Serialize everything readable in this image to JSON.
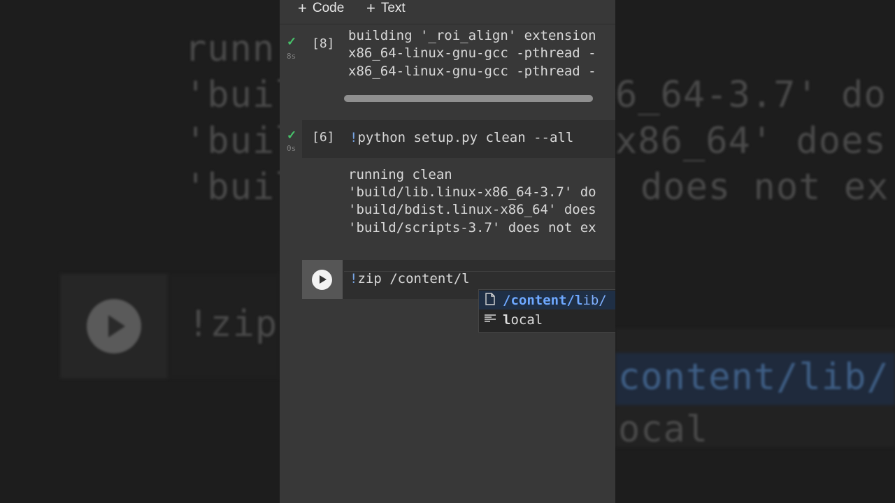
{
  "toolbar": {
    "add_code_label": "Code",
    "add_text_label": "Text"
  },
  "cells": {
    "c8": {
      "exec_count": "[8]",
      "exec_time": "8s",
      "output_lines": [
        "building '_roi_align' extension",
        "x86_64-linux-gnu-gcc -pthread -",
        "x86_64-linux-gnu-gcc -pthread -"
      ]
    },
    "c6": {
      "exec_count": "[6]",
      "exec_time": "0s",
      "bang": "!",
      "code": "python setup.py clean --all",
      "output_lines": [
        "running clean",
        "'build/lib.linux-x86_64-3.7' do",
        "'build/bdist.linux-x86_64' does",
        "'build/scripts-3.7' does not ex"
      ]
    },
    "active": {
      "bang": "!",
      "code": "zip /content/l"
    }
  },
  "autocomplete": {
    "items": [
      {
        "match": "/content/l",
        "rest": "ib/",
        "icon": "file-icon",
        "selected": true
      },
      {
        "match": "l",
        "rest": "ocal",
        "icon": "text-icon",
        "selected": false
      }
    ]
  },
  "background": {
    "left_lines": [
      "runn",
      "'buil",
      "'buil",
      "'buil"
    ],
    "left_code": "!zip",
    "right_lines": [
      "6_64-3.7' do",
      "x86_64' does",
      "does not ex"
    ],
    "right_suggest_1": "content/lib/",
    "right_suggest_2": "ocal"
  },
  "colors": {
    "accent_blue": "#78a5e4",
    "check_green": "#47c26a",
    "selection_bg": "#1f2f45"
  }
}
